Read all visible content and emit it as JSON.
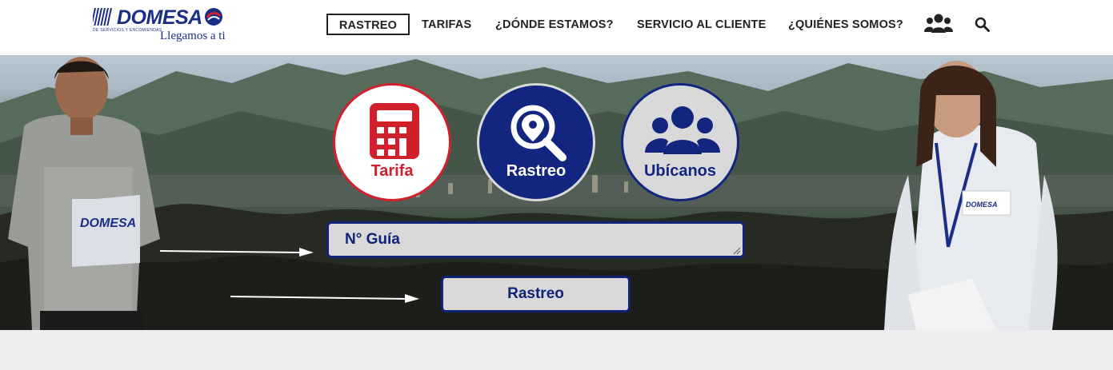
{
  "brand": {
    "name": "DOMESA",
    "tagline": "Llegamos a ti",
    "subtext": "DE SERVICIOS Y ENCOMIENDAS"
  },
  "nav": {
    "items": [
      "RASTREO",
      "TARIFAS",
      "¿DÓNDE ESTAMOS?",
      "SERVICIO AL CLIENTE",
      "¿QUIÉNES SOMOS?"
    ],
    "active": "RASTREO",
    "icons": [
      "users-icon",
      "search-icon"
    ]
  },
  "hero": {
    "circles": [
      {
        "label": "Tarifa",
        "icon": "calculator-icon"
      },
      {
        "label": "Rastreo",
        "icon": "location-search-icon"
      },
      {
        "label": "Ubícanos",
        "icon": "group-icon"
      }
    ],
    "guia_placeholder": "N° Guía",
    "button_label": "Rastreo",
    "badge_text": "DOMESA"
  },
  "colors": {
    "brand_blue": "#0f2378",
    "tarifa_red": "#d0202b",
    "circle_bg": "#ffffff",
    "circle_grey": "#d9d9d9",
    "footer_bg": "#eeeeee"
  }
}
